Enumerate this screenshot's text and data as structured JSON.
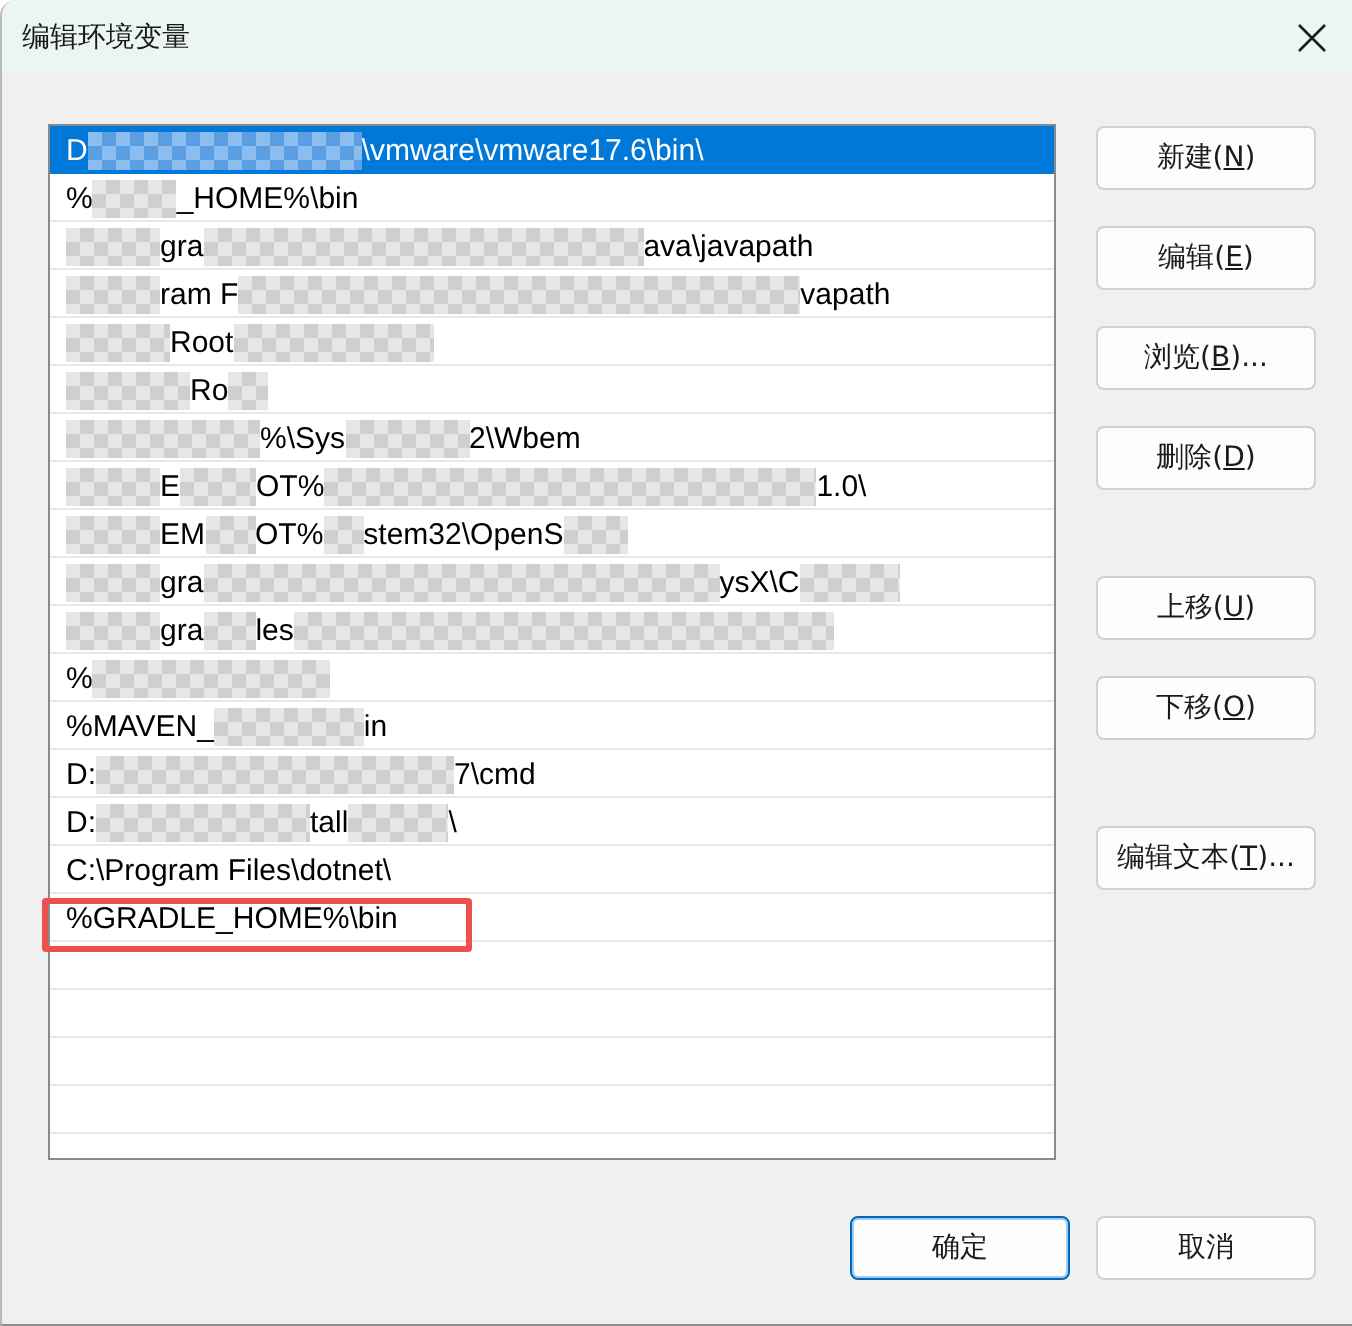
{
  "window": {
    "title": "编辑环境变量"
  },
  "path_list": {
    "rows": [
      {
        "selected": true,
        "annotated": false,
        "segments": [
          {
            "kind": "text",
            "text": "D"
          },
          {
            "kind": "redacted"
          },
          {
            "kind": "text",
            "text": "\\vmware\\vmware17.6\\bin\\"
          }
        ]
      },
      {
        "selected": false,
        "annotated": false,
        "segments": [
          {
            "kind": "text",
            "text": "%"
          },
          {
            "kind": "redacted"
          },
          {
            "kind": "text",
            "text": "_HOME%\\bin"
          }
        ]
      },
      {
        "selected": false,
        "annotated": false,
        "segments": [
          {
            "kind": "redacted"
          },
          {
            "kind": "text",
            "text": "gra"
          },
          {
            "kind": "redacted"
          },
          {
            "kind": "text",
            "text": "ava\\javapath"
          }
        ]
      },
      {
        "selected": false,
        "annotated": false,
        "segments": [
          {
            "kind": "redacted"
          },
          {
            "kind": "text",
            "text": "ram F"
          },
          {
            "kind": "redacted"
          },
          {
            "kind": "text",
            "text": "vapath"
          }
        ]
      },
      {
        "selected": false,
        "annotated": false,
        "segments": [
          {
            "kind": "redacted"
          },
          {
            "kind": "text",
            "text": "Root"
          },
          {
            "kind": "redacted"
          }
        ]
      },
      {
        "selected": false,
        "annotated": false,
        "segments": [
          {
            "kind": "redacted"
          },
          {
            "kind": "text",
            "text": "Ro"
          },
          {
            "kind": "redacted"
          }
        ]
      },
      {
        "selected": false,
        "annotated": false,
        "segments": [
          {
            "kind": "redacted"
          },
          {
            "kind": "text",
            "text": "%\\Sys"
          },
          {
            "kind": "redacted"
          },
          {
            "kind": "text",
            "text": "2\\Wbem"
          }
        ]
      },
      {
        "selected": false,
        "annotated": false,
        "segments": [
          {
            "kind": "redacted"
          },
          {
            "kind": "text",
            "text": "E"
          },
          {
            "kind": "redacted"
          },
          {
            "kind": "text",
            "text": "OT%"
          },
          {
            "kind": "redacted"
          },
          {
            "kind": "text",
            "text": "1.0\\"
          }
        ]
      },
      {
        "selected": false,
        "annotated": false,
        "segments": [
          {
            "kind": "redacted"
          },
          {
            "kind": "text",
            "text": "EM"
          },
          {
            "kind": "redacted"
          },
          {
            "kind": "text",
            "text": "OT%"
          },
          {
            "kind": "redacted"
          },
          {
            "kind": "text",
            "text": "stem32\\OpenS"
          },
          {
            "kind": "redacted"
          }
        ]
      },
      {
        "selected": false,
        "annotated": false,
        "segments": [
          {
            "kind": "redacted"
          },
          {
            "kind": "text",
            "text": "gra"
          },
          {
            "kind": "redacted"
          },
          {
            "kind": "text",
            "text": "ysX\\C"
          },
          {
            "kind": "redacted"
          }
        ]
      },
      {
        "selected": false,
        "annotated": false,
        "segments": [
          {
            "kind": "redacted"
          },
          {
            "kind": "text",
            "text": "gra"
          },
          {
            "kind": "redacted"
          },
          {
            "kind": "text",
            "text": "les"
          },
          {
            "kind": "redacted"
          }
        ]
      },
      {
        "selected": false,
        "annotated": false,
        "segments": [
          {
            "kind": "text",
            "text": "%"
          },
          {
            "kind": "redacted"
          }
        ]
      },
      {
        "selected": false,
        "annotated": false,
        "segments": [
          {
            "kind": "text",
            "text": "%MAVEN_"
          },
          {
            "kind": "redacted"
          },
          {
            "kind": "text",
            "text": "in"
          }
        ]
      },
      {
        "selected": false,
        "annotated": false,
        "segments": [
          {
            "kind": "text",
            "text": "D:"
          },
          {
            "kind": "redacted"
          },
          {
            "kind": "text",
            "text": "7\\cmd"
          }
        ]
      },
      {
        "selected": false,
        "annotated": false,
        "segments": [
          {
            "kind": "text",
            "text": "D:"
          },
          {
            "kind": "redacted"
          },
          {
            "kind": "text",
            "text": "tall"
          },
          {
            "kind": "redacted"
          },
          {
            "kind": "text",
            "text": "\\"
          }
        ]
      },
      {
        "selected": false,
        "annotated": false,
        "segments": [
          {
            "kind": "text",
            "text": "C:\\Program Files\\dotnet\\"
          }
        ]
      },
      {
        "selected": false,
        "annotated": true,
        "segments": [
          {
            "kind": "text",
            "text": "%GRADLE_HOME%\\bin"
          }
        ]
      }
    ]
  },
  "side_buttons": [
    [
      {
        "text_before": "新建(",
        "access_key": "N",
        "text_after": ")"
      },
      {
        "text_before": "编辑(",
        "access_key": "E",
        "text_after": ")"
      },
      {
        "text_before": "浏览(",
        "access_key": "B",
        "text_after": ")..."
      },
      {
        "text_before": "删除(",
        "access_key": "D",
        "text_after": ")"
      }
    ],
    [
      {
        "text_before": "上移(",
        "access_key": "U",
        "text_after": ")"
      },
      {
        "text_before": "下移(",
        "access_key": "O",
        "text_after": ")"
      }
    ],
    [
      {
        "text_before": "编辑文本(",
        "access_key": "T",
        "text_after": ")..."
      }
    ]
  ],
  "footer_buttons": [
    {
      "label": "确定",
      "default": true
    },
    {
      "label": "取消",
      "default": false
    }
  ]
}
